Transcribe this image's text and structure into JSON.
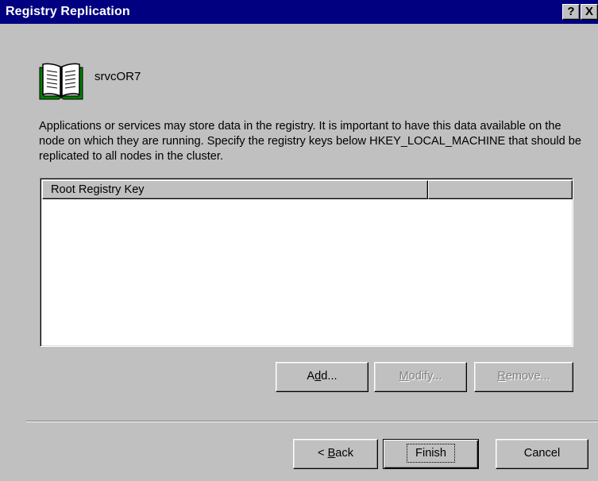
{
  "window": {
    "title": "Registry Replication",
    "help_glyph": "?",
    "close_glyph": "X"
  },
  "resource": {
    "name": "srvcOR7",
    "icon": "book-icon"
  },
  "description": "Applications or services may store data in the registry. It is important to have this data available on the node on which they are running. Specify the registry keys below HKEY_LOCAL_MACHINE that should be replicated to all nodes in the cluster.",
  "list": {
    "columns": [
      "Root Registry Key",
      ""
    ],
    "rows": []
  },
  "buttons": {
    "add": {
      "pre": "A",
      "key": "d",
      "post": "d..."
    },
    "modify": {
      "pre": "",
      "key": "M",
      "post": "odify..."
    },
    "remove": {
      "pre": "",
      "key": "R",
      "post": "emove..."
    },
    "back": {
      "pre": "< ",
      "key": "B",
      "post": "ack"
    },
    "finish": "Finish",
    "cancel": "Cancel"
  },
  "colors": {
    "titlebar": "#000080",
    "face": "#c0c0c0",
    "list_bg": "#ffffff",
    "icon_green": "#008000"
  }
}
